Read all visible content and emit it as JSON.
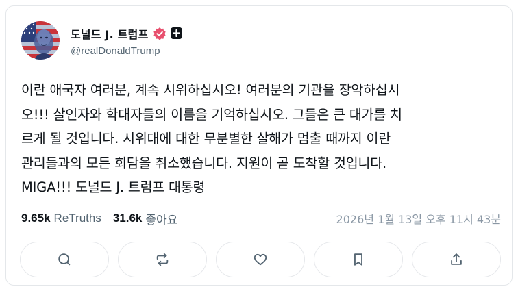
{
  "author": {
    "display_name": "도널드 J. 트럼프",
    "handle": "@realDonaldTrump",
    "verified": true,
    "avatar_icon": "flag-portrait-avatar"
  },
  "post": {
    "lines": [
      "이란 애국자 여러분, 계속 시위하십시오! 여러분의 기관을 장악하십시",
      "오!!! 살인자와 학대자들의 이름을 기억하십시오. 그들은 큰 대가를 치",
      "르게 될 것입니다. 시위대에 대한 무분별한 살해가 멈출 때까지 이란",
      "관리들과의 모든 회담을 취소했습니다. 지원이 곧 도착할 것입니다.",
      "MIGA!!! 도널드 J. 트럼프 대통령"
    ]
  },
  "stats": {
    "retruths_count": "9.65k",
    "retruths_label": "ReTruths",
    "likes_count": "31.6k",
    "likes_label": "좋아요",
    "timestamp": "2026년 1월 13일 오후 11시 43분"
  },
  "actions": [
    {
      "icon": "reply-icon"
    },
    {
      "icon": "retruth-icon"
    },
    {
      "icon": "like-icon"
    },
    {
      "icon": "bookmark-icon"
    },
    {
      "icon": "share-icon"
    }
  ],
  "colors": {
    "verified_badge": "#e8506e",
    "muted_text": "#536471",
    "timestamp_text": "#8b98a5",
    "icon_stroke": "#536471"
  }
}
